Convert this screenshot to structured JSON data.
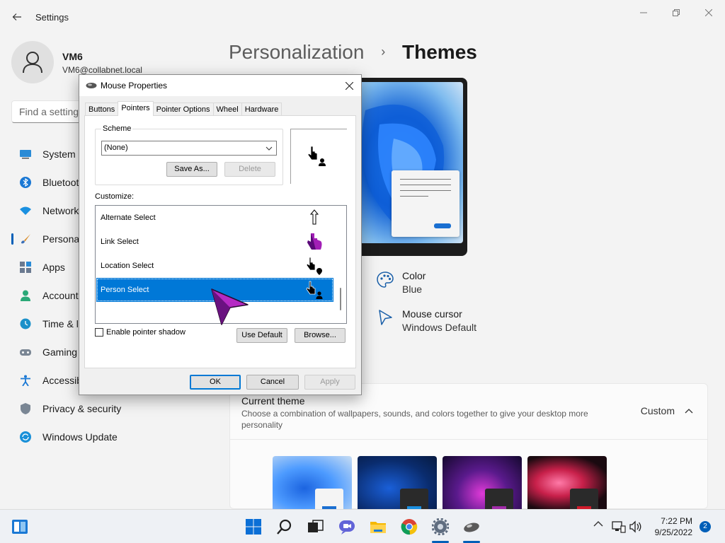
{
  "settings": {
    "app_title": "Settings",
    "user": {
      "name": "VM6",
      "email": "VM6@collabnet.local"
    },
    "search": {
      "placeholder": "Find a setting"
    },
    "nav": [
      {
        "label": "System",
        "icon": "system-icon"
      },
      {
        "label": "Bluetooth & devices",
        "icon": "bluetooth-icon"
      },
      {
        "label": "Network & internet",
        "icon": "network-icon"
      },
      {
        "label": "Personalization",
        "icon": "personalization-icon",
        "active": true
      },
      {
        "label": "Apps",
        "icon": "apps-icon"
      },
      {
        "label": "Accounts",
        "icon": "accounts-icon"
      },
      {
        "label": "Time & language",
        "icon": "time-icon"
      },
      {
        "label": "Gaming",
        "icon": "gaming-icon"
      },
      {
        "label": "Accessibility",
        "icon": "accessibility-icon"
      },
      {
        "label": "Privacy & security",
        "icon": "shield-icon"
      },
      {
        "label": "Windows Update",
        "icon": "update-icon"
      }
    ],
    "breadcrumb": {
      "parent": "Personalization",
      "separator": "›",
      "current": "Themes"
    },
    "color": {
      "label": "Color",
      "value": "Blue"
    },
    "cursor": {
      "label": "Mouse cursor",
      "value": "Windows Default"
    },
    "current_theme": {
      "title": "Current theme",
      "description": "Choose a combination of wallpapers, sounds, and colors together to give your desktop more personality",
      "value": "Custom"
    }
  },
  "dialog": {
    "title": "Mouse Properties",
    "tabs": [
      "Buttons",
      "Pointers",
      "Pointer Options",
      "Wheel",
      "Hardware"
    ],
    "active_tab": "Pointers",
    "scheme_label": "Scheme",
    "scheme_value": "(None)",
    "save_as": "Save As...",
    "delete": "Delete",
    "customize_label": "Customize:",
    "cursors": [
      {
        "label": "Alternate Select"
      },
      {
        "label": "Link Select"
      },
      {
        "label": "Location Select"
      },
      {
        "label": "Person Select",
        "selected": true
      }
    ],
    "enable_shadow": "Enable pointer shadow",
    "use_default": "Use Default",
    "browse": "Browse...",
    "ok": "OK",
    "cancel": "Cancel",
    "apply": "Apply"
  },
  "taskbar": {
    "time": "7:22 PM",
    "date": "9/25/2022",
    "notifications": "2"
  },
  "colors": {
    "accent": "#005fb8",
    "selection": "#0078d7"
  }
}
